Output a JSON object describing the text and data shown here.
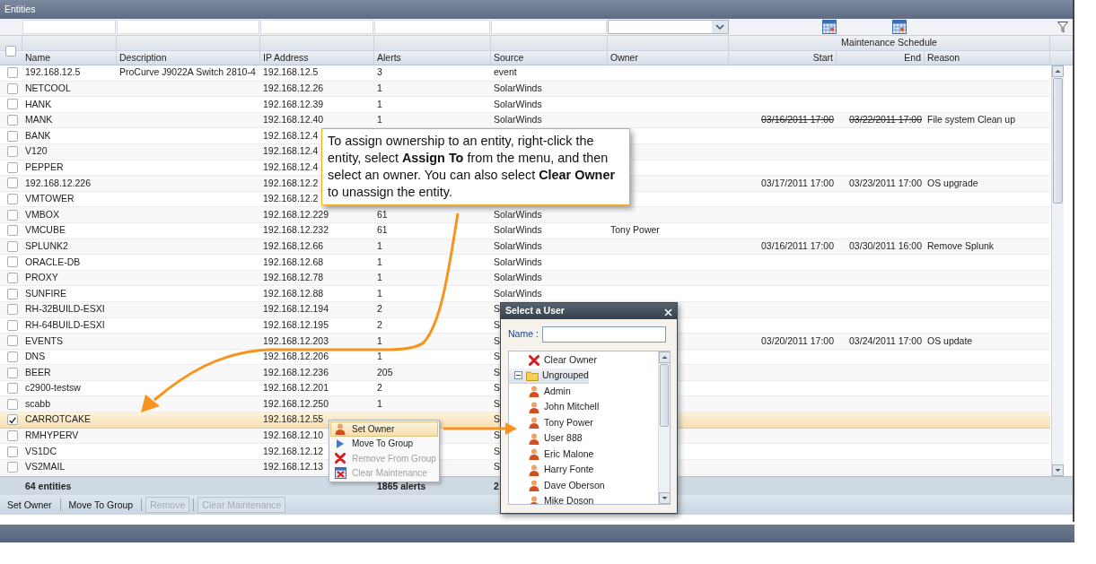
{
  "window": {
    "title": "Entities"
  },
  "table": {
    "group_header": "Maintenance Schedule",
    "select_all_checked": false,
    "columns": [
      "Name",
      "Description",
      "IP Address",
      "Alerts",
      "Source",
      "Owner",
      "Start",
      "End",
      "Reason"
    ],
    "rows": [
      {
        "name": "192.168.12.5",
        "description": "ProCurve J9022A Switch 2810-4",
        "ip": "192.168.12.5",
        "alerts": "3",
        "source": "event",
        "checked": false,
        "selected": false
      },
      {
        "name": "NETCOOL",
        "ip": "192.168.12.26",
        "alerts": "1",
        "source": "SolarWinds",
        "checked": false,
        "selected": false
      },
      {
        "name": "HANK",
        "ip": "192.168.12.39",
        "alerts": "1",
        "source": "SolarWinds",
        "checked": false,
        "selected": false
      },
      {
        "name": "MANK",
        "ip": "192.168.12.40",
        "alerts": "1",
        "source": "SolarWinds",
        "start": "03/16/2011 17:00",
        "end": "03/22/2011 17:00",
        "reason": "File system Clean up",
        "checked": false,
        "selected": false,
        "expired": true
      },
      {
        "name": "BANK",
        "ip": "192.168.12.4",
        "checked": false,
        "selected": false
      },
      {
        "name": "V120",
        "ip": "192.168.12.4",
        "checked": false,
        "selected": false
      },
      {
        "name": "PEPPER",
        "ip": "192.168.12.4",
        "checked": false,
        "selected": false
      },
      {
        "name": "192.168.12.226",
        "ip": "192.168.12.2",
        "start": "03/17/2011 17:00",
        "end": "03/23/2011 17:00",
        "reason": "OS upgrade",
        "checked": false,
        "selected": false,
        "expired": false
      },
      {
        "name": "VMTOWER",
        "ip": "192.168.12.2",
        "checked": false,
        "selected": false
      },
      {
        "name": "VMBOX",
        "ip": "192.168.12.229",
        "alerts": "61",
        "source": "SolarWinds",
        "checked": false,
        "selected": false
      },
      {
        "name": "VMCUBE",
        "ip": "192.168.12.232",
        "alerts": "61",
        "source": "SolarWinds",
        "owner": "Tony Power",
        "checked": false,
        "selected": false
      },
      {
        "name": "SPLUNK2",
        "ip": "192.168.12.66",
        "alerts": "1",
        "source": "SolarWinds",
        "start": "03/16/2011 17:00",
        "end": "03/30/2011 16:00",
        "reason": "Remove Splunk",
        "checked": false,
        "selected": false,
        "expired": false
      },
      {
        "name": "ORACLE-DB",
        "ip": "192.168.12.68",
        "alerts": "1",
        "source": "SolarWinds",
        "checked": false,
        "selected": false
      },
      {
        "name": "PROXY",
        "ip": "192.168.12.78",
        "alerts": "1",
        "source": "SolarWinds",
        "checked": false,
        "selected": false
      },
      {
        "name": "SUNFIRE",
        "ip": "192.168.12.88",
        "alerts": "1",
        "source": "SolarWinds",
        "checked": false,
        "selected": false
      },
      {
        "name": "RH-32BUILD-ESXI",
        "ip": "192.168.12.194",
        "alerts": "2",
        "source": "S",
        "checked": false,
        "selected": false
      },
      {
        "name": "RH-64BUILD-ESXI",
        "ip": "192.168.12.195",
        "alerts": "2",
        "source": "S",
        "checked": false,
        "selected": false
      },
      {
        "name": "EVENTS",
        "ip": "192.168.12.203",
        "alerts": "1",
        "source": "S",
        "start": "03/20/2011 17:00",
        "end": "03/24/2011 17:00",
        "reason": "OS update",
        "checked": false,
        "selected": false,
        "expired": false
      },
      {
        "name": "DNS",
        "ip": "192.168.12.206",
        "alerts": "1",
        "source": "S",
        "checked": false,
        "selected": false
      },
      {
        "name": "BEER",
        "ip": "192.168.12.236",
        "alerts": "205",
        "source": "S",
        "checked": false,
        "selected": false
      },
      {
        "name": "c2900-testsw",
        "ip": "192.168.12.201",
        "alerts": "2",
        "source": "S",
        "checked": false,
        "selected": false
      },
      {
        "name": "scabb",
        "ip": "192.168.12.250",
        "alerts": "1",
        "source": "S",
        "checked": false,
        "selected": false
      },
      {
        "name": "CARROTCAKE",
        "ip": "192.168.12.55",
        "source": "S",
        "checked": true,
        "selected": true
      },
      {
        "name": "RMHYPERV",
        "ip": "192.168.12.10",
        "source": "S",
        "checked": false,
        "selected": false
      },
      {
        "name": "VS1DC",
        "ip": "192.168.12.12",
        "source": "S",
        "checked": false,
        "selected": false
      },
      {
        "name": "VS2MAIL",
        "ip": "192.168.12.13",
        "source": "S",
        "checked": false,
        "selected": false
      }
    ],
    "footer": {
      "name": "64 entities",
      "alerts": "1865 alerts",
      "source": "2"
    }
  },
  "toolbar": [
    {
      "label": "Set Owner",
      "disabled": false
    },
    {
      "label": "Move To Group",
      "disabled": false
    },
    {
      "label": "Remove",
      "disabled": true
    },
    {
      "label": "Clear Maintenance",
      "disabled": true
    }
  ],
  "callout": {
    "text": "To assign ownership to an entity, right-click the entity, select **Assign To** from the menu, and then select an owner. You can also select **Clear Owner** to unassign the entity."
  },
  "context_menu": [
    {
      "label": "Set Owner",
      "kind": "user",
      "selected": true,
      "disabled": false
    },
    {
      "label": "Move To Group",
      "kind": "move",
      "selected": false,
      "disabled": false
    },
    {
      "label": "Remove From Group",
      "kind": "remove",
      "selected": false,
      "disabled": true
    },
    {
      "label": "Clear Maintenance",
      "kind": "maintenance",
      "selected": false,
      "disabled": true
    }
  ],
  "dialog": {
    "title": "Select a User",
    "name_label": "Name :",
    "items": [
      {
        "kind": "action",
        "label": "Clear Owner"
      },
      {
        "kind": "group",
        "label": "Ungrouped",
        "expanded": true,
        "children": [
          {
            "label": "Admin"
          },
          {
            "label": "John Mitchell"
          },
          {
            "label": "Tony Power"
          },
          {
            "label": "User 888"
          },
          {
            "label": "Eric Malone"
          },
          {
            "label": "Harry Fonte"
          },
          {
            "label": "Dave Oberson"
          },
          {
            "label": "Mike Doson"
          }
        ]
      }
    ]
  }
}
